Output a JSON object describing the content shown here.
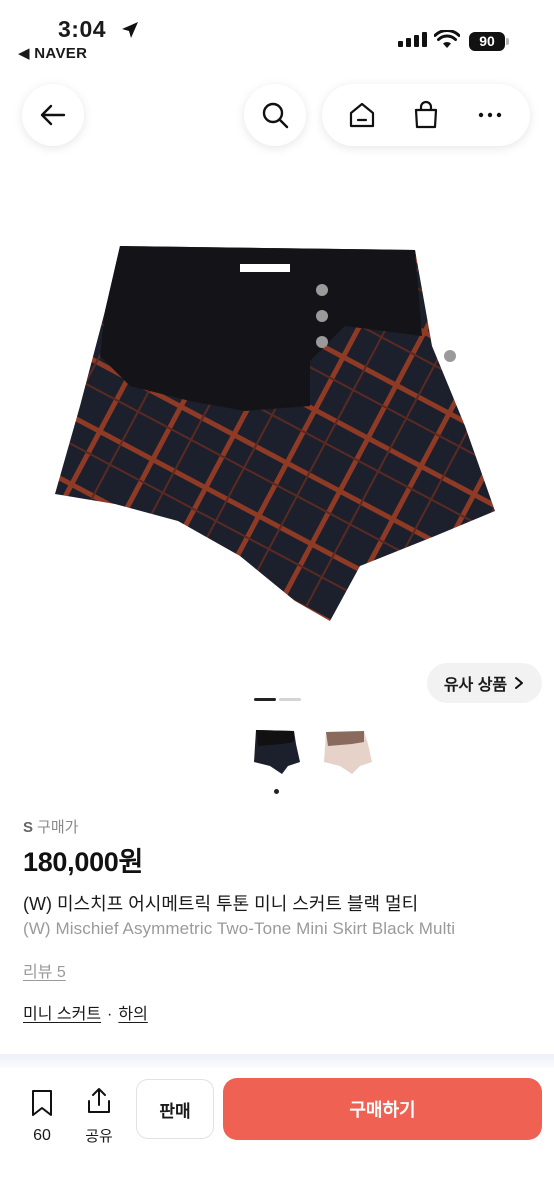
{
  "status_bar": {
    "time": "3:04",
    "back_app": "◀ NAVER",
    "battery": "90"
  },
  "nav": {
    "icons": [
      "arrow-left-icon",
      "search-icon",
      "home-icon",
      "shopping-bag-icon",
      "more-icon"
    ]
  },
  "gallery": {
    "similar_label": "유사 상품",
    "image_index": 1,
    "image_count": 2
  },
  "product": {
    "price_label_prefix": "S",
    "price_label": "구매가",
    "price": "180,000원",
    "title_ko": "(W) 미스치프 어시메트릭 투톤 미니 스커트 블랙 멀티",
    "title_en": "(W) Mischief Asymmetric Two-Tone Mini Skirt Black Multi",
    "review": "리뷰 5",
    "category": "미니 스커트",
    "category_separator": "·",
    "category_parent": "하의"
  },
  "bottom_bar": {
    "bookmark_count": "60",
    "share_label": "공유",
    "sell_label": "판매",
    "buy_label": "구매하기"
  },
  "colors": {
    "accent": "#ef6253",
    "text_primary": "#1a1a1a",
    "text_secondary": "#9a9a9a"
  }
}
